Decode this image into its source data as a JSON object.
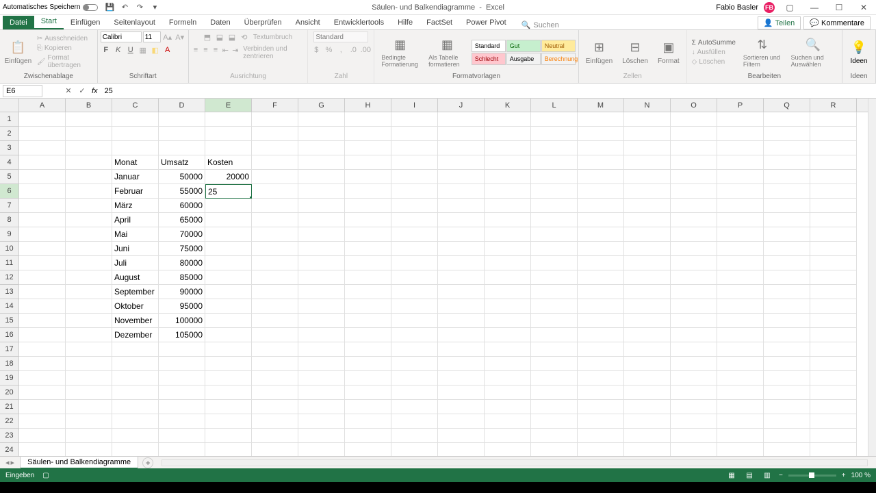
{
  "title_bar": {
    "autosave": "Automatisches Speichern",
    "doc_name": "Säulen- und Balkendiagramme",
    "app_name": "Excel",
    "user": "Fabio Basler",
    "avatar_initials": "FB"
  },
  "tabs": {
    "file": "Datei",
    "items": [
      "Start",
      "Einfügen",
      "Seitenlayout",
      "Formeln",
      "Daten",
      "Überprüfen",
      "Ansicht",
      "Entwicklertools",
      "Hilfe",
      "FactSet",
      "Power Pivot"
    ],
    "search": "Suchen",
    "share": "Teilen",
    "comments": "Kommentare"
  },
  "ribbon": {
    "paste": "Einfügen",
    "cut": "Ausschneiden",
    "copy": "Kopieren",
    "format_painter": "Format übertragen",
    "clipboard": "Zwischenablage",
    "font_name": "Calibri",
    "font_size": "11",
    "font": "Schriftart",
    "wrap": "Textumbruch",
    "merge": "Verbinden und zentrieren",
    "alignment": "Ausrichtung",
    "number_format": "Standard",
    "number": "Zahl",
    "cond_format": "Bedingte Formatierung",
    "as_table": "Als Tabelle formatieren",
    "style_standard": "Standard",
    "style_gut": "Gut",
    "style_neutral": "Neutral",
    "style_schlecht": "Schlecht",
    "style_ausgabe": "Ausgabe",
    "style_berechnung": "Berechnung",
    "styles": "Formatvorlagen",
    "insert": "Einfügen",
    "delete": "Löschen",
    "format": "Format",
    "cells": "Zellen",
    "autosum": "AutoSumme",
    "fill": "Ausfüllen",
    "clear": "Löschen",
    "sort": "Sortieren und Filtern",
    "find": "Suchen und Auswählen",
    "editing": "Bearbeiten",
    "ideas": "Ideen",
    "ideas_label": "Ideen"
  },
  "formula_bar": {
    "cell_ref": "E6",
    "value": "25"
  },
  "grid": {
    "cols": [
      "A",
      "B",
      "C",
      "D",
      "E",
      "F",
      "G",
      "H",
      "I",
      "J",
      "K",
      "L",
      "M",
      "N",
      "O",
      "P",
      "Q",
      "R"
    ],
    "active_col": "E",
    "active_row": 6,
    "rows": 24,
    "editing_value": "25",
    "data": {
      "C4": "Monat",
      "D4": "Umsatz",
      "E4": "Kosten",
      "C5": "Januar",
      "D5": "50000",
      "E5": "20000",
      "C6": "Februar",
      "D6": "55000",
      "C7": "März",
      "D7": "60000",
      "C8": "April",
      "D8": "65000",
      "C9": "Mai",
      "D9": "70000",
      "C10": "Juni",
      "D10": "75000",
      "C11": "Juli",
      "D11": "80000",
      "C12": "August",
      "D12": "85000",
      "C13": "September",
      "D13": "90000",
      "C14": "Oktober",
      "D14": "95000",
      "C15": "November",
      "D15": "100000",
      "C16": "Dezember",
      "D16": "105000"
    }
  },
  "sheet": {
    "name": "Säulen- und Balkendiagramme"
  },
  "status": {
    "mode": "Eingeben",
    "zoom": "100 %"
  },
  "chart_data": {
    "type": "table",
    "title": "Monat / Umsatz / Kosten",
    "columns": [
      "Monat",
      "Umsatz",
      "Kosten"
    ],
    "rows": [
      [
        "Januar",
        50000,
        20000
      ],
      [
        "Februar",
        55000,
        null
      ],
      [
        "März",
        60000,
        null
      ],
      [
        "April",
        65000,
        null
      ],
      [
        "Mai",
        70000,
        null
      ],
      [
        "Juni",
        75000,
        null
      ],
      [
        "Juli",
        80000,
        null
      ],
      [
        "August",
        85000,
        null
      ],
      [
        "September",
        90000,
        null
      ],
      [
        "Oktober",
        95000,
        null
      ],
      [
        "November",
        100000,
        null
      ],
      [
        "Dezember",
        105000,
        null
      ]
    ]
  }
}
